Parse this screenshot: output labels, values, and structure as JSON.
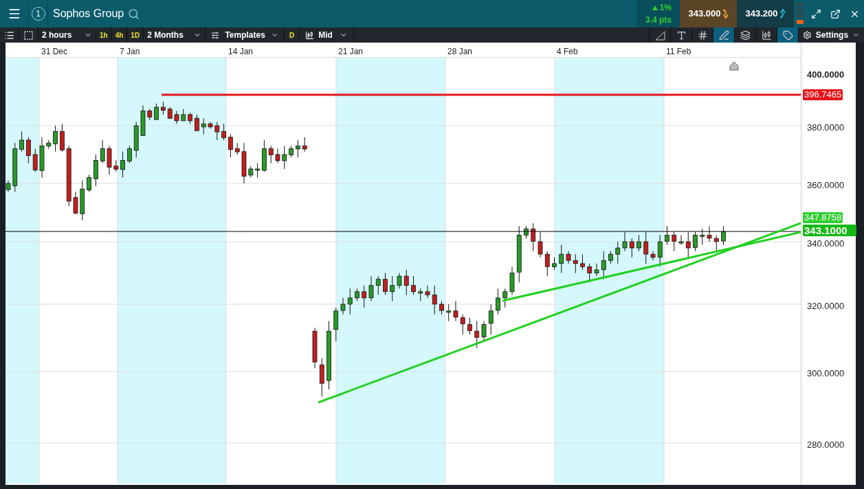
{
  "header": {
    "alert_count": "1",
    "instrument": "Sophos Group",
    "change": {
      "rising": true,
      "percent": "1%",
      "points": "3.4 pts"
    },
    "sell": "343.000",
    "buy": "343.200"
  },
  "toolbar": {
    "interval": "2 hours",
    "quick_intervals": [
      "1h",
      "4h",
      "1D"
    ],
    "range": "2 Months",
    "templates": "Templates",
    "d_button": "D",
    "price_type": "Mid",
    "settings": "Settings",
    "tools": [
      {
        "kind": "trend",
        "selected": false
      },
      {
        "kind": "text",
        "selected": false
      },
      {
        "kind": "grid",
        "selected": false
      },
      {
        "kind": "draw-grid",
        "selected": true
      },
      {
        "kind": "layers",
        "selected": false
      },
      {
        "kind": "candle",
        "selected": false
      },
      {
        "kind": "tag",
        "selected": true
      }
    ]
  },
  "date_axis": [
    "31 Dec",
    "7 Jan",
    "14 Jan",
    "21 Jan",
    "28 Jan",
    "4 Feb",
    "11 Feb"
  ],
  "price_axis": [
    {
      "label": "400.0000",
      "bold": true
    },
    {
      "label": "380.0000",
      "bold": false
    },
    {
      "label": "360.0000",
      "bold": false
    },
    {
      "label": "340.0000",
      "bold": false
    },
    {
      "label": "320.0000",
      "bold": false
    },
    {
      "label": "300.0000",
      "bold": false
    },
    {
      "label": "280.0000",
      "bold": false
    }
  ],
  "price_tags": [
    {
      "label": "396.7465",
      "color": "#e8141b"
    },
    {
      "label": "347.8758",
      "color": "#2fcf2f"
    },
    {
      "label": "343.1000",
      "color": "#14b814"
    }
  ]
}
